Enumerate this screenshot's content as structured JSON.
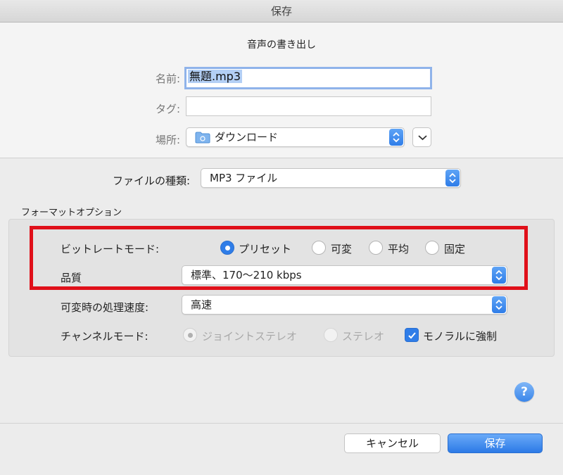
{
  "window": {
    "title": "保存"
  },
  "dialog": {
    "subtitle": "音声の書き出し",
    "name_label": "名前:",
    "name_value": "無題.mp3",
    "tag_label": "タグ:",
    "tag_value": "",
    "location_label": "場所:",
    "location_value": "ダウンロード",
    "location_icon": "folder-icon",
    "filetype_label": "ファイルの種類:",
    "filetype_value": "MP3 ファイル"
  },
  "format_options": {
    "section_title": "フォーマットオプション",
    "bitrate_mode": {
      "label": "ビットレートモード:",
      "options": [
        "プリセット",
        "可変",
        "平均",
        "固定"
      ],
      "selected": "プリセット"
    },
    "quality": {
      "label": "品質",
      "value": "標準、170〜210 kbps"
    },
    "vbr_speed": {
      "label": "可変時の処理速度:",
      "value": "高速"
    },
    "channel_mode": {
      "label": "チャンネルモード:",
      "options": [
        "ジョイントステレオ",
        "ステレオ"
      ],
      "force_mono_label": "モノラルに強制",
      "force_mono_checked": true
    },
    "highlight_color": "#e0101a"
  },
  "buttons": {
    "help": "?",
    "cancel": "キャンセル",
    "save": "保存"
  },
  "colors": {
    "accent": "#2f7de8"
  }
}
